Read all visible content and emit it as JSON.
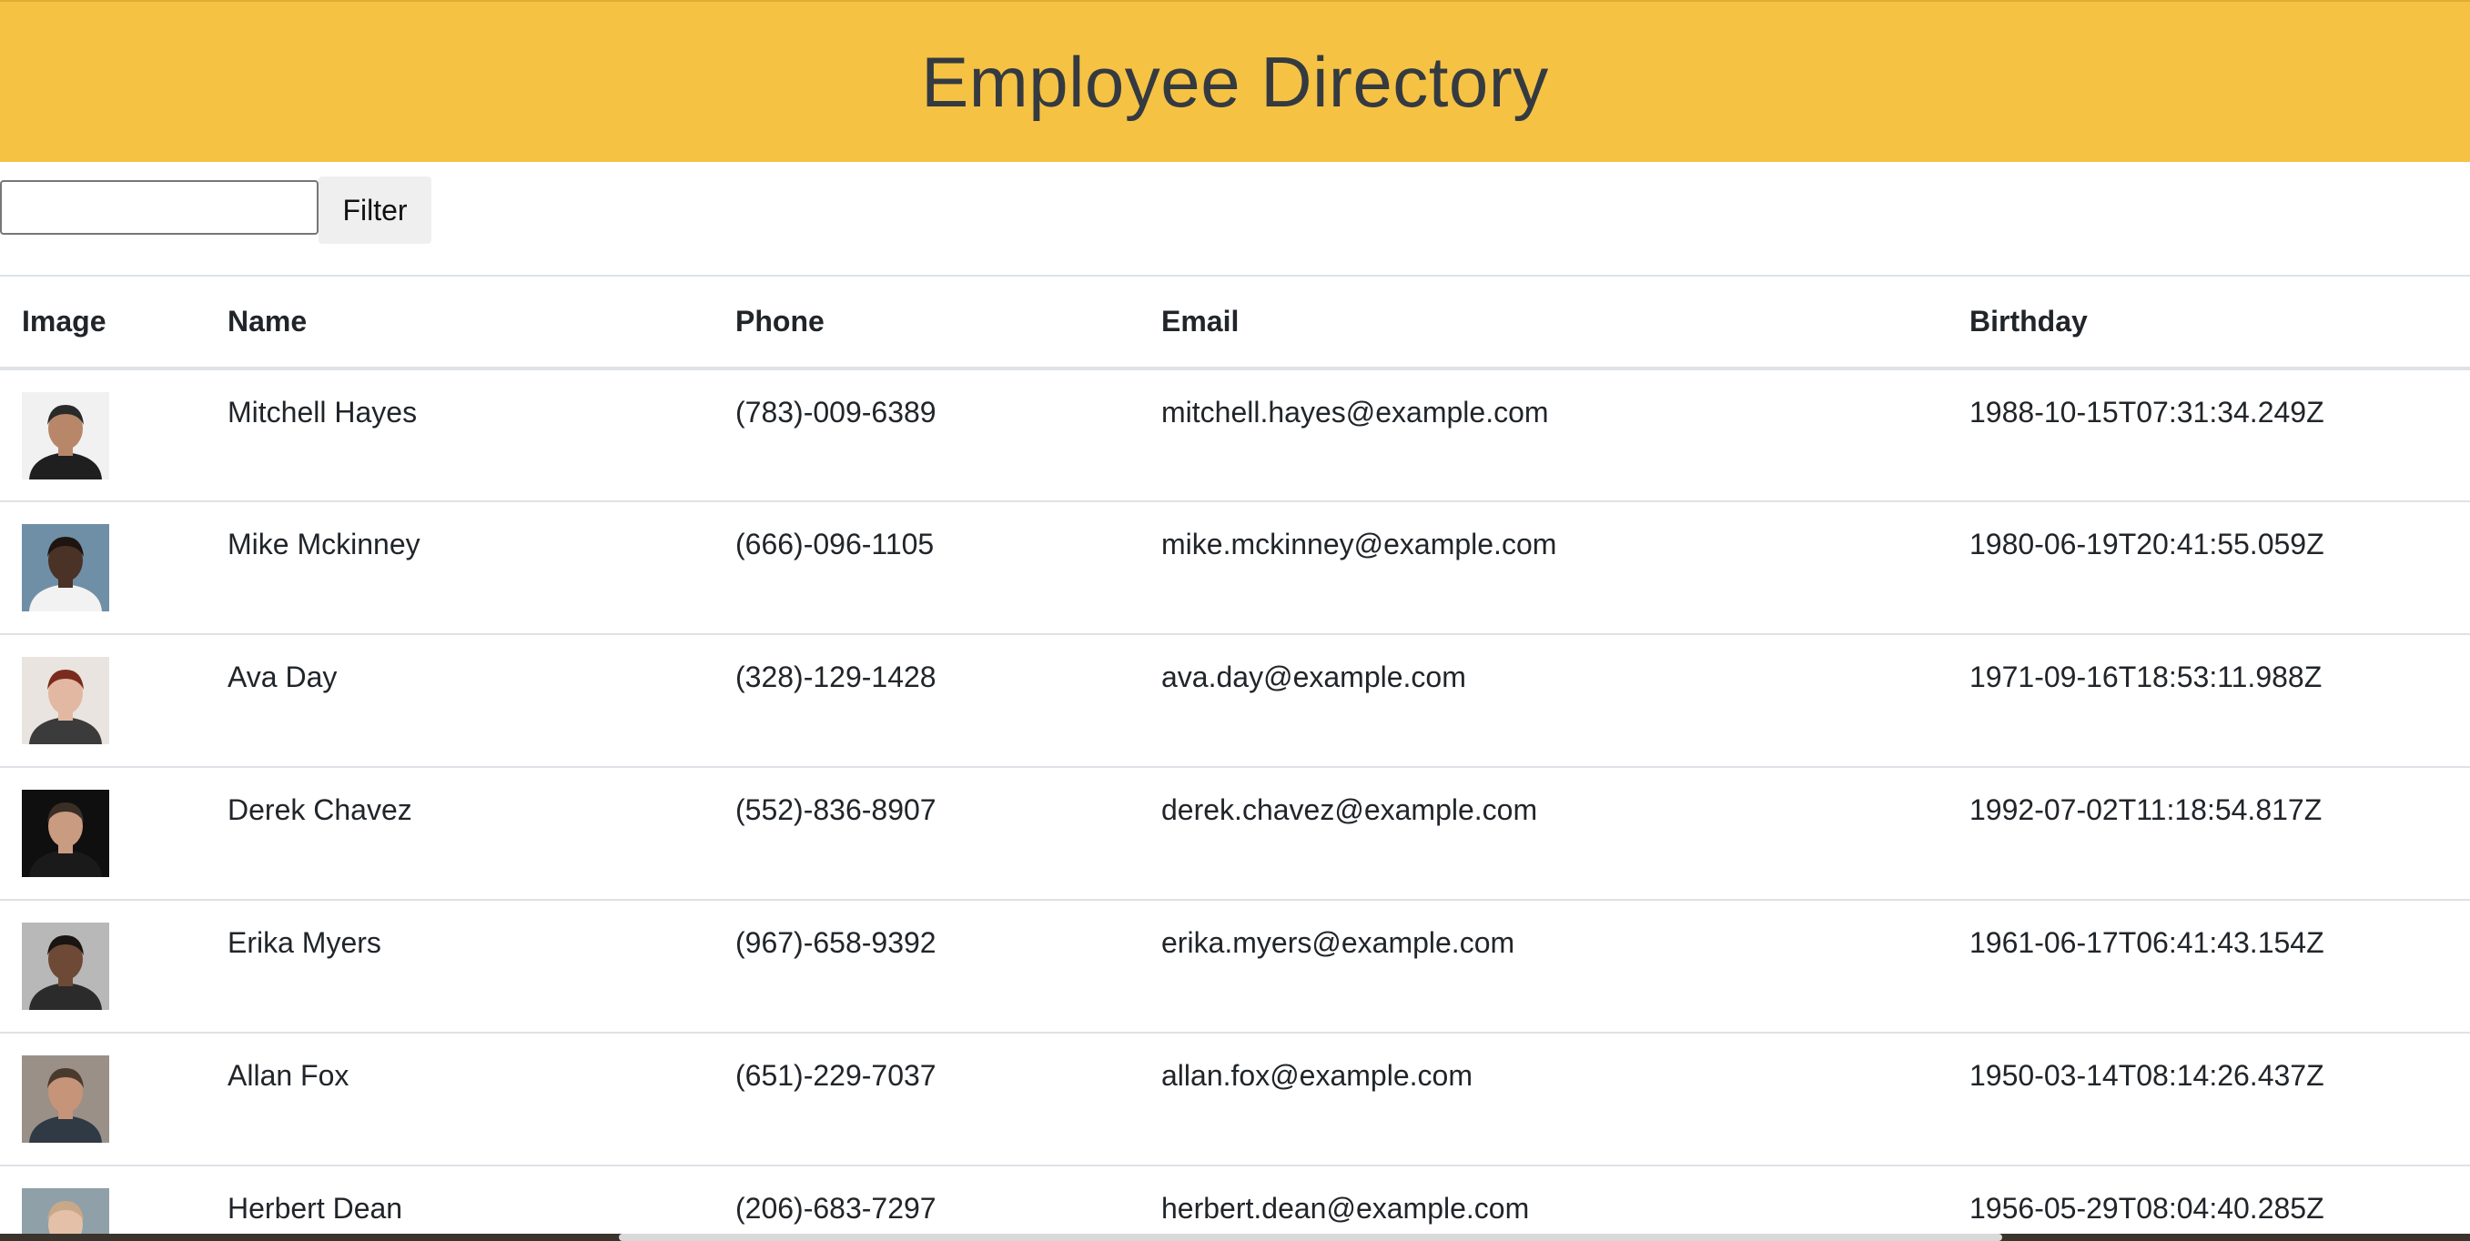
{
  "header": {
    "title": "Employee Directory"
  },
  "filter": {
    "input_value": "",
    "button_label": "Filter"
  },
  "table": {
    "columns": [
      "Image",
      "Name",
      "Phone",
      "Email",
      "Birthday"
    ],
    "rows": [
      {
        "name": "Mitchell Hayes",
        "phone": "(783)-009-6389",
        "email": "mitchell.hayes@example.com",
        "birthday": "1988-10-15T07:31:34.249Z",
        "avatar_colors": {
          "bg": "#f1f1f1",
          "skin": "#b8876a",
          "hair": "#2a2a2a",
          "shirt": "#1f1f1f"
        }
      },
      {
        "name": "Mike Mckinney",
        "phone": "(666)-096-1105",
        "email": "mike.mckinney@example.com",
        "birthday": "1980-06-19T20:41:55.059Z",
        "avatar_colors": {
          "bg": "#6f8fa6",
          "skin": "#4a3226",
          "hair": "#1e1410",
          "shirt": "#f2f2f2"
        }
      },
      {
        "name": "Ava Day",
        "phone": "(328)-129-1428",
        "email": "ava.day@example.com",
        "birthday": "1971-09-16T18:53:11.988Z",
        "avatar_colors": {
          "bg": "#e9e4e0",
          "skin": "#e2b8a2",
          "hair": "#7a2b1d",
          "shirt": "#3b3b3b"
        }
      },
      {
        "name": "Derek Chavez",
        "phone": "(552)-836-8907",
        "email": "derek.chavez@example.com",
        "birthday": "1992-07-02T11:18:54.817Z",
        "avatar_colors": {
          "bg": "#0f0f0f",
          "skin": "#c99b80",
          "hair": "#3a2e26",
          "shirt": "#1a1a1a"
        }
      },
      {
        "name": "Erika Myers",
        "phone": "(967)-658-9392",
        "email": "erika.myers@example.com",
        "birthday": "1961-06-17T06:41:43.154Z",
        "avatar_colors": {
          "bg": "#b8b8b8",
          "skin": "#6e4a36",
          "hair": "#1a1412",
          "shirt": "#2b2b2b"
        }
      },
      {
        "name": "Allan Fox",
        "phone": "(651)-229-7037",
        "email": "allan.fox@example.com",
        "birthday": "1950-03-14T08:14:26.437Z",
        "avatar_colors": {
          "bg": "#9a9088",
          "skin": "#c69478",
          "hair": "#4a3a2e",
          "shirt": "#2f3a44"
        }
      },
      {
        "name": "Herbert Dean",
        "phone": "(206)-683-7297",
        "email": "herbert.dean@example.com",
        "birthday": "1956-05-29T08:04:40.285Z",
        "avatar_colors": {
          "bg": "#8fa0a8",
          "skin": "#e4c0a8",
          "hair": "#c8a889",
          "shirt": "#4a5a66"
        }
      }
    ]
  },
  "colors": {
    "header_bg": "#f5c244",
    "header_text": "#343a40",
    "row_border": "#dee2e6"
  }
}
